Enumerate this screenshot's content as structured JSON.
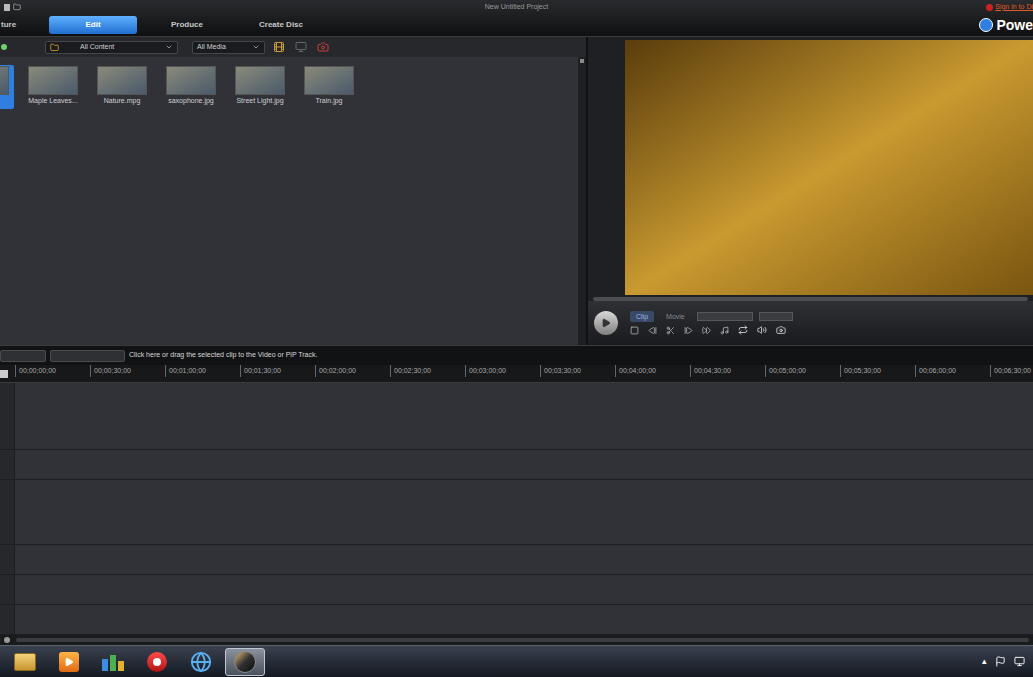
{
  "window": {
    "title": "New Untitled Project"
  },
  "tabs": [
    {
      "label": "ture",
      "selected": false
    },
    {
      "label": "Edit",
      "selected": true
    },
    {
      "label": "Produce",
      "selected": false
    },
    {
      "label": "Create Disc",
      "selected": false
    }
  ],
  "account": {
    "sign_in": "Sign in to Di"
  },
  "brand": {
    "name": "Powe"
  },
  "library": {
    "content_filter": "All Content",
    "media_filter": "All Media",
    "items": [
      {
        "selected": true
      },
      {
        "label": "Maple Leaves...",
        "selected": false
      },
      {
        "label": "Nature.mpg",
        "selected": false
      },
      {
        "label": "saxophone.jpg",
        "selected": false
      },
      {
        "label": "Street Light.jpg",
        "selected": false
      },
      {
        "label": "Train.jpg",
        "selected": false
      }
    ]
  },
  "player": {
    "tabs": [
      {
        "label": "Clip",
        "selected": true
      },
      {
        "label": "Movie",
        "selected": false
      }
    ]
  },
  "timeline": {
    "hint": "Click here or drag the selected clip to the Video or PiP Track.",
    "ruler": [
      "00;00;00;00",
      "00;00;30;00",
      "00;01;00;00",
      "00;01;30;00",
      "00;02;00;00",
      "00;02;30;00",
      "00;03;00;00",
      "00;03;30;00",
      "00;04;00;00",
      "00;04;30;00",
      "00;05;00;00",
      "00;05;30;00",
      "00;06;00;00",
      "00;06;30;00"
    ]
  },
  "taskbar": {
    "apps": [
      {
        "kind": "explorer",
        "selected": false
      },
      {
        "kind": "media",
        "selected": false
      },
      {
        "kind": "photos",
        "selected": false
      },
      {
        "kind": "recorder",
        "selected": false
      },
      {
        "kind": "browser",
        "selected": false
      },
      {
        "kind": "director",
        "selected": true
      }
    ],
    "tray": "▴"
  }
}
